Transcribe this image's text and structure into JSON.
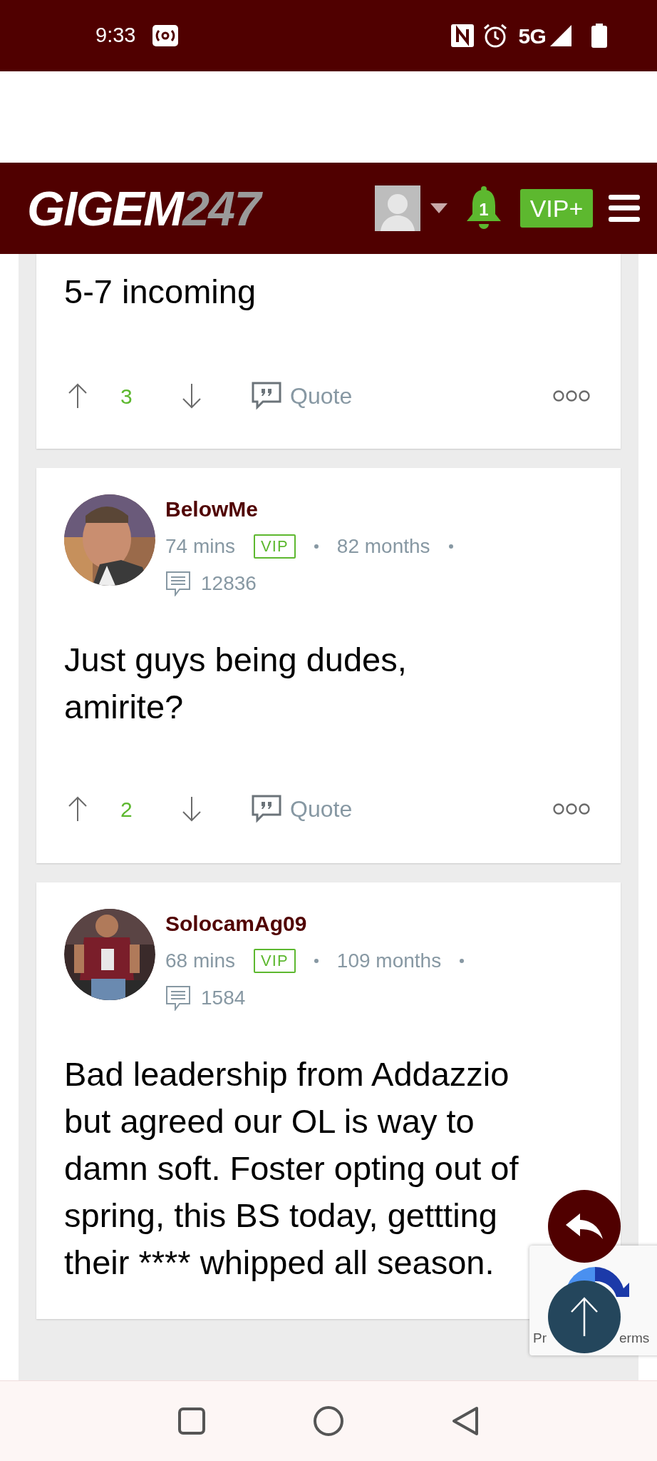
{
  "status_bar": {
    "time": "9:33",
    "network": "5G"
  },
  "header": {
    "logo_main": "GIGEM",
    "logo_suffix": "247",
    "notification_count": "1",
    "vip_button": "VIP+"
  },
  "posts": [
    {
      "body": "5-7 incoming",
      "upvotes": "3",
      "quote": "Quote"
    },
    {
      "author": "BelowMe",
      "time": "74 mins",
      "badge": "VIP",
      "tenure": "82 months",
      "post_count": "12836",
      "body": "Just guys being dudes, amirite?",
      "upvotes": "2",
      "quote": "Quote"
    },
    {
      "author": "SolocamAg09",
      "time": "68 mins",
      "badge": "VIP",
      "tenure": "109 months",
      "post_count": "1584",
      "body": "Bad leadership from Addazzio but agreed our OL is way to damn soft. Foster opting out of spring, this BS today, gettting their **** whipped all season."
    }
  ],
  "recaptcha": {
    "left_text": "Pr",
    "right_text": "erms"
  }
}
